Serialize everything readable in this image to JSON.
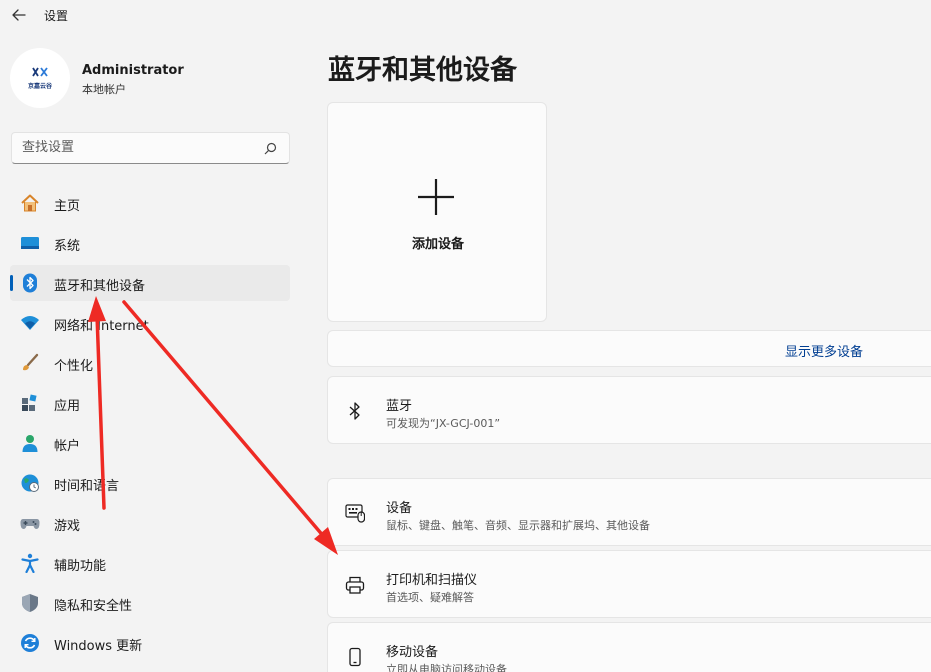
{
  "window": {
    "title": "设置"
  },
  "account": {
    "name": "Administrator",
    "type": "本地帐户",
    "logo_text": "京嘉云谷"
  },
  "search": {
    "placeholder": "查找设置"
  },
  "nav": {
    "items": [
      {
        "label": "主页",
        "icon": "home-icon"
      },
      {
        "label": "系统",
        "icon": "system-icon"
      },
      {
        "label": "蓝牙和其他设备",
        "icon": "bluetooth-icon",
        "active": true
      },
      {
        "label": "网络和 Internet",
        "icon": "wifi-icon"
      },
      {
        "label": "个性化",
        "icon": "brush-icon"
      },
      {
        "label": "应用",
        "icon": "apps-icon"
      },
      {
        "label": "帐户",
        "icon": "person-icon"
      },
      {
        "label": "时间和语言",
        "icon": "globe-icon"
      },
      {
        "label": "游戏",
        "icon": "gamepad-icon"
      },
      {
        "label": "辅助功能",
        "icon": "accessibility-icon"
      },
      {
        "label": "隐私和安全性",
        "icon": "shield-icon"
      },
      {
        "label": "Windows 更新",
        "icon": "update-icon"
      }
    ]
  },
  "main": {
    "title": "蓝牙和其他设备",
    "add_device": {
      "label": "添加设备"
    },
    "show_more": "显示更多设备",
    "bluetooth": {
      "title": "蓝牙",
      "subtitle": "可发现为“JX-GCJ-001”"
    },
    "devices": {
      "title": "设备",
      "subtitle": "鼠标、键盘、触笔、音频、显示器和扩展坞、其他设备"
    },
    "printers": {
      "title": "打印机和扫描仪",
      "subtitle": "首选项、疑难解答"
    },
    "mobile": {
      "title": "移动设备",
      "subtitle": "立即从电脑访问移动设备"
    }
  },
  "colors": {
    "accent": "#005fb8",
    "link": "#003e92",
    "annotation_arrow": "#ee2a24"
  }
}
